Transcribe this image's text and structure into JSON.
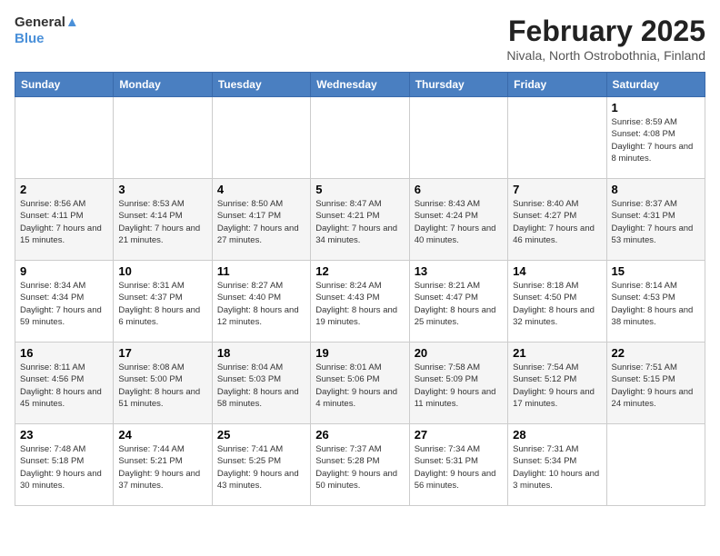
{
  "header": {
    "logo_line1": "General",
    "logo_line2": "Blue",
    "title": "February 2025",
    "subtitle": "Nivala, North Ostrobothnia, Finland"
  },
  "weekdays": [
    "Sunday",
    "Monday",
    "Tuesday",
    "Wednesday",
    "Thursday",
    "Friday",
    "Saturday"
  ],
  "weeks": [
    [
      {
        "day": "",
        "info": ""
      },
      {
        "day": "",
        "info": ""
      },
      {
        "day": "",
        "info": ""
      },
      {
        "day": "",
        "info": ""
      },
      {
        "day": "",
        "info": ""
      },
      {
        "day": "",
        "info": ""
      },
      {
        "day": "1",
        "info": "Sunrise: 8:59 AM\nSunset: 4:08 PM\nDaylight: 7 hours and 8 minutes."
      }
    ],
    [
      {
        "day": "2",
        "info": "Sunrise: 8:56 AM\nSunset: 4:11 PM\nDaylight: 7 hours and 15 minutes."
      },
      {
        "day": "3",
        "info": "Sunrise: 8:53 AM\nSunset: 4:14 PM\nDaylight: 7 hours and 21 minutes."
      },
      {
        "day": "4",
        "info": "Sunrise: 8:50 AM\nSunset: 4:17 PM\nDaylight: 7 hours and 27 minutes."
      },
      {
        "day": "5",
        "info": "Sunrise: 8:47 AM\nSunset: 4:21 PM\nDaylight: 7 hours and 34 minutes."
      },
      {
        "day": "6",
        "info": "Sunrise: 8:43 AM\nSunset: 4:24 PM\nDaylight: 7 hours and 40 minutes."
      },
      {
        "day": "7",
        "info": "Sunrise: 8:40 AM\nSunset: 4:27 PM\nDaylight: 7 hours and 46 minutes."
      },
      {
        "day": "8",
        "info": "Sunrise: 8:37 AM\nSunset: 4:31 PM\nDaylight: 7 hours and 53 minutes."
      }
    ],
    [
      {
        "day": "9",
        "info": "Sunrise: 8:34 AM\nSunset: 4:34 PM\nDaylight: 7 hours and 59 minutes."
      },
      {
        "day": "10",
        "info": "Sunrise: 8:31 AM\nSunset: 4:37 PM\nDaylight: 8 hours and 6 minutes."
      },
      {
        "day": "11",
        "info": "Sunrise: 8:27 AM\nSunset: 4:40 PM\nDaylight: 8 hours and 12 minutes."
      },
      {
        "day": "12",
        "info": "Sunrise: 8:24 AM\nSunset: 4:43 PM\nDaylight: 8 hours and 19 minutes."
      },
      {
        "day": "13",
        "info": "Sunrise: 8:21 AM\nSunset: 4:47 PM\nDaylight: 8 hours and 25 minutes."
      },
      {
        "day": "14",
        "info": "Sunrise: 8:18 AM\nSunset: 4:50 PM\nDaylight: 8 hours and 32 minutes."
      },
      {
        "day": "15",
        "info": "Sunrise: 8:14 AM\nSunset: 4:53 PM\nDaylight: 8 hours and 38 minutes."
      }
    ],
    [
      {
        "day": "16",
        "info": "Sunrise: 8:11 AM\nSunset: 4:56 PM\nDaylight: 8 hours and 45 minutes."
      },
      {
        "day": "17",
        "info": "Sunrise: 8:08 AM\nSunset: 5:00 PM\nDaylight: 8 hours and 51 minutes."
      },
      {
        "day": "18",
        "info": "Sunrise: 8:04 AM\nSunset: 5:03 PM\nDaylight: 8 hours and 58 minutes."
      },
      {
        "day": "19",
        "info": "Sunrise: 8:01 AM\nSunset: 5:06 PM\nDaylight: 9 hours and 4 minutes."
      },
      {
        "day": "20",
        "info": "Sunrise: 7:58 AM\nSunset: 5:09 PM\nDaylight: 9 hours and 11 minutes."
      },
      {
        "day": "21",
        "info": "Sunrise: 7:54 AM\nSunset: 5:12 PM\nDaylight: 9 hours and 17 minutes."
      },
      {
        "day": "22",
        "info": "Sunrise: 7:51 AM\nSunset: 5:15 PM\nDaylight: 9 hours and 24 minutes."
      }
    ],
    [
      {
        "day": "23",
        "info": "Sunrise: 7:48 AM\nSunset: 5:18 PM\nDaylight: 9 hours and 30 minutes."
      },
      {
        "day": "24",
        "info": "Sunrise: 7:44 AM\nSunset: 5:21 PM\nDaylight: 9 hours and 37 minutes."
      },
      {
        "day": "25",
        "info": "Sunrise: 7:41 AM\nSunset: 5:25 PM\nDaylight: 9 hours and 43 minutes."
      },
      {
        "day": "26",
        "info": "Sunrise: 7:37 AM\nSunset: 5:28 PM\nDaylight: 9 hours and 50 minutes."
      },
      {
        "day": "27",
        "info": "Sunrise: 7:34 AM\nSunset: 5:31 PM\nDaylight: 9 hours and 56 minutes."
      },
      {
        "day": "28",
        "info": "Sunrise: 7:31 AM\nSunset: 5:34 PM\nDaylight: 10 hours and 3 minutes."
      },
      {
        "day": "",
        "info": ""
      }
    ]
  ]
}
